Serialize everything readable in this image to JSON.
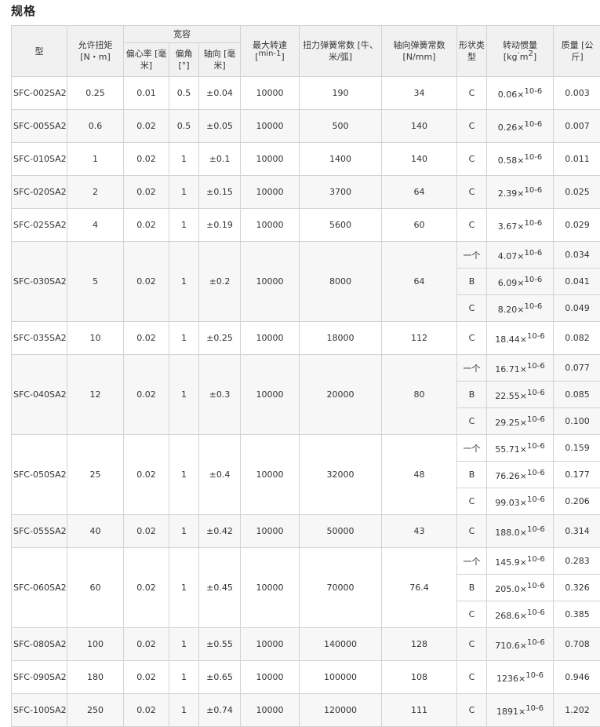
{
  "page_title": "规格",
  "table": {
    "headers": {
      "model": "型",
      "torque": "允许扭矩 [N・m]",
      "tolerance": "宽容",
      "eccentricity": "偏心率 [毫米]",
      "angle": "偏角 [°]",
      "axial": "轴向 [毫米]",
      "max_speed_prefix": "最大转速 [",
      "max_speed_unit": "min-1",
      "max_speed_suffix": "]",
      "torsion_spring": "扭力弹簧常数 [牛、米/弧]",
      "axial_spring": "轴向弹簧常数 [N/mm]",
      "shape": "形状类型",
      "inertia_prefix": "转动惯量 [",
      "inertia_unit_base": "kg",
      "inertia_unit_dot": "·",
      "inertia_unit_m": "m",
      "inertia_unit_exp": "2",
      "inertia_suffix": "]",
      "mass": "质量 [公斤]"
    },
    "exp_base": "×",
    "exp_power": "10-6",
    "rows": [
      {
        "model": "SFC-002SA2",
        "torque": "0.25",
        "ecc": "0.01",
        "angle": "0.5",
        "axial": "±0.04",
        "speed": "10000",
        "torsion": "190",
        "axial_spring": "34",
        "variants": [
          {
            "shape": "C",
            "inertia": "0.06",
            "mass": "0.003"
          }
        ]
      },
      {
        "model": "SFC-005SA2",
        "torque": "0.6",
        "ecc": "0.02",
        "angle": "0.5",
        "axial": "±0.05",
        "speed": "10000",
        "torsion": "500",
        "axial_spring": "140",
        "variants": [
          {
            "shape": "C",
            "inertia": "0.26",
            "mass": "0.007"
          }
        ]
      },
      {
        "model": "SFC-010SA2",
        "torque": "1",
        "ecc": "0.02",
        "angle": "1",
        "axial": "±0.1",
        "speed": "10000",
        "torsion": "1400",
        "axial_spring": "140",
        "variants": [
          {
            "shape": "C",
            "inertia": "0.58",
            "mass": "0.011"
          }
        ]
      },
      {
        "model": "SFC-020SA2",
        "torque": "2",
        "ecc": "0.02",
        "angle": "1",
        "axial": "±0.15",
        "speed": "10000",
        "torsion": "3700",
        "axial_spring": "64",
        "variants": [
          {
            "shape": "C",
            "inertia": "2.39",
            "mass": "0.025"
          }
        ]
      },
      {
        "model": "SFC-025SA2",
        "torque": "4",
        "ecc": "0.02",
        "angle": "1",
        "axial": "±0.19",
        "speed": "10000",
        "torsion": "5600",
        "axial_spring": "60",
        "variants": [
          {
            "shape": "C",
            "inertia": "3.67",
            "mass": "0.029"
          }
        ]
      },
      {
        "model": "SFC-030SA2",
        "torque": "5",
        "ecc": "0.02",
        "angle": "1",
        "axial": "±0.2",
        "speed": "10000",
        "torsion": "8000",
        "axial_spring": "64",
        "variants": [
          {
            "shape": "一个",
            "inertia": "4.07",
            "mass": "0.034"
          },
          {
            "shape": "B",
            "inertia": "6.09",
            "mass": "0.041"
          },
          {
            "shape": "C",
            "inertia": "8.20",
            "mass": "0.049"
          }
        ]
      },
      {
        "model": "SFC-035SA2",
        "torque": "10",
        "ecc": "0.02",
        "angle": "1",
        "axial": "±0.25",
        "speed": "10000",
        "torsion": "18000",
        "axial_spring": "112",
        "variants": [
          {
            "shape": "C",
            "inertia": "18.44",
            "mass": "0.082"
          }
        ]
      },
      {
        "model": "SFC-040SA2",
        "torque": "12",
        "ecc": "0.02",
        "angle": "1",
        "axial": "±0.3",
        "speed": "10000",
        "torsion": "20000",
        "axial_spring": "80",
        "variants": [
          {
            "shape": "一个",
            "inertia": "16.71",
            "mass": "0.077"
          },
          {
            "shape": "B",
            "inertia": "22.55",
            "mass": "0.085"
          },
          {
            "shape": "C",
            "inertia": "29.25",
            "mass": "0.100"
          }
        ]
      },
      {
        "model": "SFC-050SA2",
        "torque": "25",
        "ecc": "0.02",
        "angle": "1",
        "axial": "±0.4",
        "speed": "10000",
        "torsion": "32000",
        "axial_spring": "48",
        "variants": [
          {
            "shape": "一个",
            "inertia": "55.71",
            "mass": "0.159"
          },
          {
            "shape": "B",
            "inertia": "76.26",
            "mass": "0.177"
          },
          {
            "shape": "C",
            "inertia": "99.03",
            "mass": "0.206"
          }
        ]
      },
      {
        "model": "SFC-055SA2",
        "torque": "40",
        "ecc": "0.02",
        "angle": "1",
        "axial": "±0.42",
        "speed": "10000",
        "torsion": "50000",
        "axial_spring": "43",
        "variants": [
          {
            "shape": "C",
            "inertia": "188.0",
            "mass": "0.314"
          }
        ]
      },
      {
        "model": "SFC-060SA2",
        "torque": "60",
        "ecc": "0.02",
        "angle": "1",
        "axial": "±0.45",
        "speed": "10000",
        "torsion": "70000",
        "axial_spring": "76.4",
        "variants": [
          {
            "shape": "一个",
            "inertia": "145.9",
            "mass": "0.283"
          },
          {
            "shape": "B",
            "inertia": "205.0",
            "mass": "0.326"
          },
          {
            "shape": "C",
            "inertia": "268.6",
            "mass": "0.385"
          }
        ]
      },
      {
        "model": "SFC-080SA2",
        "torque": "100",
        "ecc": "0.02",
        "angle": "1",
        "axial": "±0.55",
        "speed": "10000",
        "torsion": "140000",
        "axial_spring": "128",
        "variants": [
          {
            "shape": "C",
            "inertia": "710.6",
            "mass": "0.708"
          }
        ]
      },
      {
        "model": "SFC-090SA2",
        "torque": "180",
        "ecc": "0.02",
        "angle": "1",
        "axial": "±0.65",
        "speed": "10000",
        "torsion": "100000",
        "axial_spring": "108",
        "variants": [
          {
            "shape": "C",
            "inertia": "1236",
            "mass": "0.946"
          }
        ]
      },
      {
        "model": "SFC-100SA2",
        "torque": "250",
        "ecc": "0.02",
        "angle": "1",
        "axial": "±0.74",
        "speed": "10000",
        "torsion": "120000",
        "axial_spring": "111",
        "variants": [
          {
            "shape": "C",
            "inertia": "1891",
            "mass": "1.202"
          }
        ]
      }
    ]
  }
}
